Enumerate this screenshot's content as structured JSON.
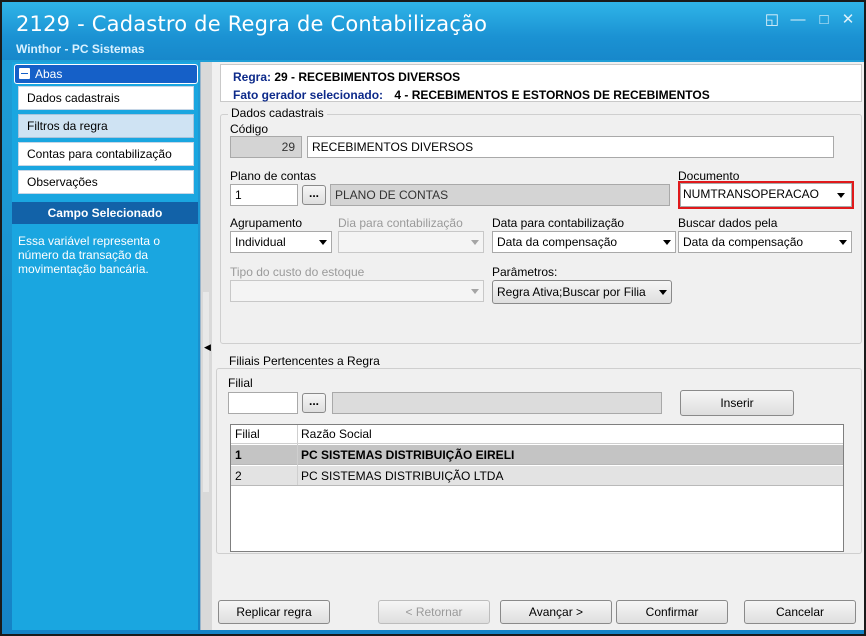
{
  "window": {
    "title": "2129 - Cadastro de Regra de Contabilização",
    "subtitle": "Winthor - PC Sistemas"
  },
  "sidebar": {
    "header": "Abas",
    "items": [
      {
        "label": "Dados cadastrais"
      },
      {
        "label": "Filtros da regra"
      },
      {
        "label": "Contas para contabilização"
      },
      {
        "label": "Observações"
      }
    ],
    "campo_header": "Campo Selecionado",
    "campo_text": "Essa variável representa o número da transação da movimentação bancária."
  },
  "info": {
    "regra_label": "Regra:",
    "regra_value": "29 - RECEBIMENTOS DIVERSOS",
    "fato_label": "Fato gerador selecionado:",
    "fato_value": "4 - RECEBIMENTOS E ESTORNOS DE RECEBIMENTOS"
  },
  "dados": {
    "group_title": "Dados cadastrais",
    "codigo_label": "Código",
    "codigo_value": "29",
    "descricao_value": "RECEBIMENTOS DIVERSOS",
    "plano_label": "Plano de contas",
    "plano_value": "1",
    "plano_desc": "PLANO DE CONTAS",
    "ellipsis": "...",
    "documento_label": "Documento",
    "documento_value": "NUMTRANSOPERACAO",
    "agrupamento_label": "Agrupamento",
    "agrupamento_value": "Individual",
    "dia_label": "Dia para contabilização",
    "dia_value": "",
    "data_label": "Data para contabilização",
    "data_value": "Data da compensação",
    "buscar_label": "Buscar dados pela",
    "buscar_value": "Data da compensação",
    "tipo_label": "Tipo do custo do estoque",
    "tipo_value": "",
    "parametros_label": "Parâmetros:",
    "parametros_value": "Regra Ativa;Buscar por Filia"
  },
  "filiais": {
    "group_title": "Filiais Pertencentes a Regra",
    "filial_label": "Filial",
    "filial_value": "",
    "inserir_label": "Inserir",
    "columns": [
      "Filial",
      "Razão Social"
    ],
    "rows": [
      {
        "filial": "1",
        "razao": "PC SISTEMAS DISTRIBUIÇÃO EIRELI"
      },
      {
        "filial": "2",
        "razao": "PC SISTEMAS DISTRIBUIÇÃO LTDA"
      }
    ]
  },
  "footer": {
    "replicar": "Replicar regra",
    "retornar": "< Retornar",
    "avancar": "Avançar >",
    "confirmar": "Confirmar",
    "cancelar": "Cancelar"
  },
  "colors": {
    "sidebar_bg": "#1aa6e0",
    "title_bg": "#1b92d3",
    "highlight_box": "#e0191b"
  }
}
